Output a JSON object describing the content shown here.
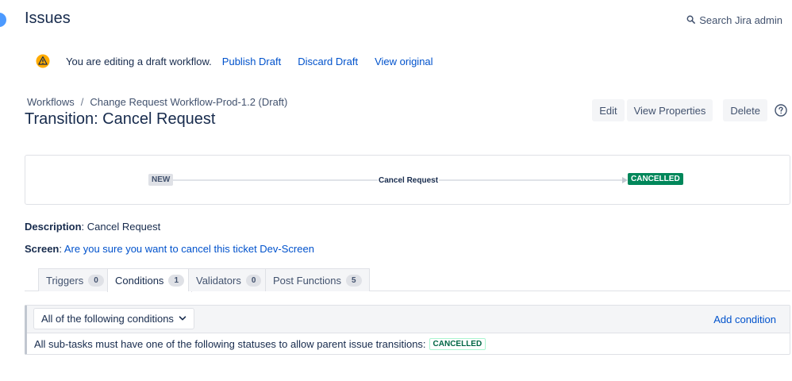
{
  "header": {
    "title": "Issues",
    "search_label": "Search Jira admin"
  },
  "draft": {
    "message": "You are editing a draft workflow.",
    "publish_label": "Publish Draft",
    "discard_label": "Discard Draft",
    "view_original_label": "View original"
  },
  "breadcrumb": {
    "root": "Workflows",
    "separator": "/",
    "current": "Change Request Workflow-Prod-1.2 (Draft)"
  },
  "page": {
    "title": "Transition: Cancel Request"
  },
  "actions": {
    "edit": "Edit",
    "view_properties": "View Properties",
    "delete": "Delete"
  },
  "diagram": {
    "from_status": "NEW",
    "transition": "Cancel Request",
    "to_status": "CANCELLED"
  },
  "details": {
    "description_label": "Description",
    "description_value": "Cancel Request",
    "screen_label": "Screen",
    "screen_value": "Are you sure you want to cancel this ticket Dev-Screen"
  },
  "tabs": [
    {
      "label": "Triggers",
      "count": "0"
    },
    {
      "label": "Conditions",
      "count": "1"
    },
    {
      "label": "Validators",
      "count": "0"
    },
    {
      "label": "Post Functions",
      "count": "5"
    }
  ],
  "conditions": {
    "selector_value": "All of the following conditions",
    "add_label": "Add condition",
    "rule_text": "All sub-tasks must have one of the following statuses to allow parent issue transitions:",
    "rule_status": "CANCELLED"
  },
  "colors": {
    "link": "#0052cc",
    "success": "#00875a",
    "warning": "#ffab00",
    "text": "#172b4d"
  },
  "icons": {
    "search": "search-icon",
    "warning": "warning-icon",
    "help": "help-icon",
    "chevron": "chevron-down-icon"
  }
}
